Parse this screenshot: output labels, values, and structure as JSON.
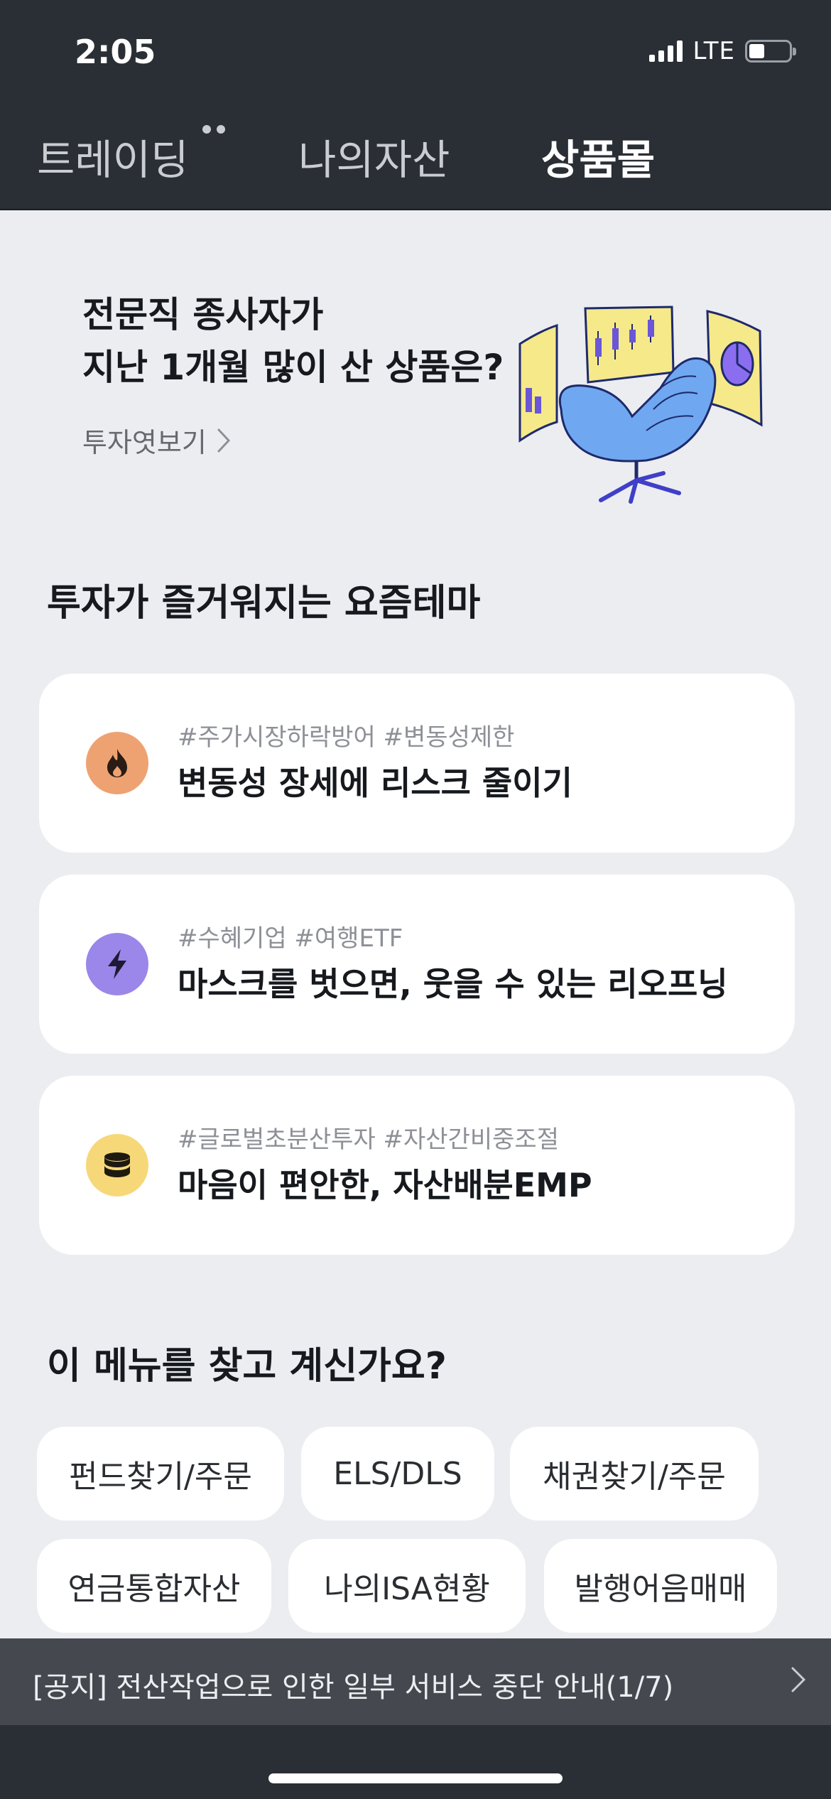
{
  "status_bar": {
    "time": "2:05",
    "network": "LTE",
    "signal_icon": "signal-bars-icon",
    "battery_icon": "battery-icon"
  },
  "nav": {
    "tabs": [
      {
        "label": "트레이딩",
        "active": false,
        "has_more_dots": true
      },
      {
        "label": "나의자산",
        "active": false
      },
      {
        "label": "상품몰",
        "active": true
      }
    ]
  },
  "banner": {
    "title_line1": "전문직 종사자가",
    "title_line2": "지난 1개월 많이 산 상품은?",
    "link_label": "투자엿보기",
    "illustration": "armchair-with-charts-illustration"
  },
  "themes_section": {
    "title": "투자가 즐거워지는 요즘테마",
    "cards": [
      {
        "tags": "#주가시장하락방어 #변동성제한",
        "title": "변동성 장세에 리스크 줄이기",
        "icon": "fire-icon",
        "icon_bg": "#eea272"
      },
      {
        "tags": "#수혜기업 #여행ETF",
        "title": "마스크를 벗으면, 웃을 수 있는 리오프닝",
        "icon": "lightning-icon",
        "icon_bg": "#9b86ea"
      },
      {
        "tags": "#글로벌초분산투자 #자산간비중조절",
        "title": "마음이 편안한, 자산배분EMP",
        "icon": "coins-stack-icon",
        "icon_bg": "#f6d879"
      }
    ]
  },
  "menu_section": {
    "title": "이 메뉴를 찾고 계신가요?",
    "chips": [
      "펀드찾기/주문",
      "ELS/DLS",
      "채권찾기/주문",
      "연금통합자산",
      "나의ISA현황",
      "발행어음매매"
    ]
  },
  "notice": {
    "text": "[공지] 전산작업으로 인한 일부 서비스 중단 안내(1/7)"
  }
}
